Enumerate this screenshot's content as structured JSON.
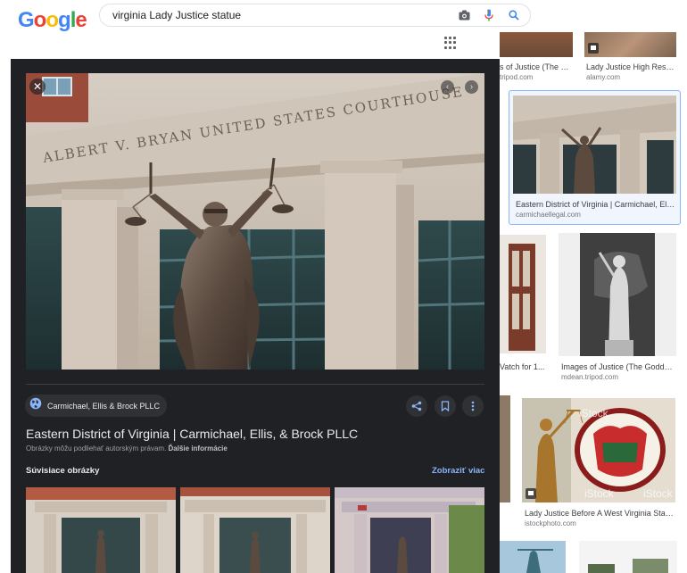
{
  "header": {
    "logo_letters": [
      "G",
      "o",
      "o",
      "g",
      "l",
      "e"
    ],
    "logo_colors": [
      "#4285f4",
      "#ea4335",
      "#fbbc05",
      "#4285f4",
      "#34a853",
      "#ea4335"
    ],
    "search_query": "virginia Lady Justice statue",
    "icons": [
      "camera-icon",
      "microphone-icon",
      "search-icon",
      "apps-grid-icon"
    ]
  },
  "grid": {
    "top_left_title": "s of Justice (The G...",
    "top_left_source": "tripod.com",
    "top_right_title": "Lady Justice High Reso...",
    "top_right_source": "alamy.com",
    "selected_title": "Eastern District of Virginia | Carmichael, Elli...",
    "selected_source": "carmichaellegal.com",
    "mid_left_title": "Vatch for 1...",
    "mid_right_title": "Images of Justice (The Godde...",
    "mid_right_source": "mdean.tripod.com",
    "bottom_title": "Lady Justice Before A West Virginia State...",
    "bottom_source": "istockphoto.com",
    "watermark": "iStock"
  },
  "panel": {
    "inscription": "ALBERT V. BRYAN UNITED STATES COURTHOUSE",
    "site_name": "Carmichael, Ellis & Brock PLLC",
    "title": "Eastern District of Virginia | Carmichael, Ellis, & Brock PLLC",
    "copyright_note": "Obrázky môžu podliehať autorským právam.",
    "more_info": "Ďalšie informácie",
    "related_heading": "Súvisiace obrázky",
    "see_more": "Zobraziť viac"
  },
  "colors": {
    "panel_bg": "#202124",
    "accent_blue": "#8ab4f8",
    "selected_border": "#8ab4f8"
  }
}
